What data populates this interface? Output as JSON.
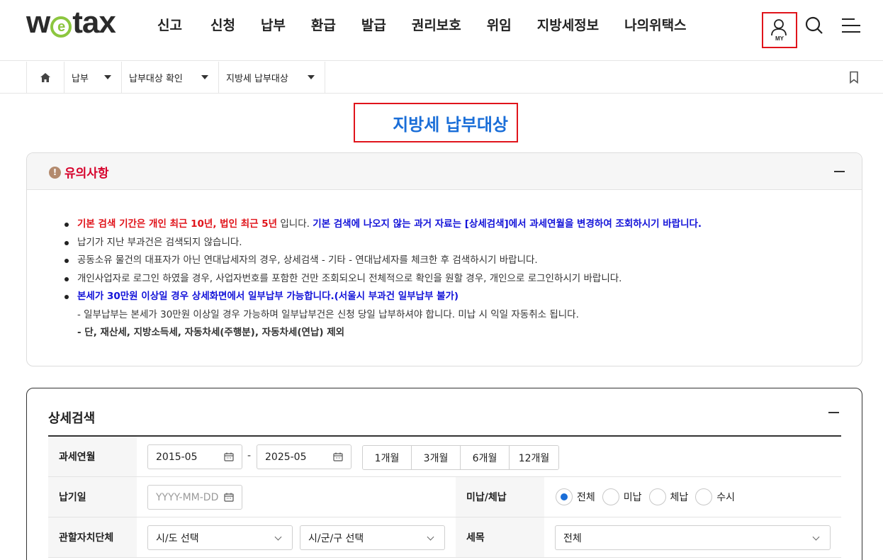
{
  "header": {
    "logo_prefix": "w",
    "logo_e": "e",
    "logo_suffix": "tax",
    "nav": [
      "신고",
      "신청",
      "납부",
      "환급",
      "발급",
      "권리보호",
      "위임",
      "지방세정보",
      "나의위택스"
    ],
    "my_label": "MY",
    "icons": {
      "my": "user-icon",
      "search": "search-icon",
      "menu": "menu-icon"
    }
  },
  "breadcrumb": {
    "home_icon": "home-icon",
    "items": [
      "납부",
      "납부대상 확인",
      "지방세 납부대상"
    ],
    "bookmark_icon": "bookmark-icon"
  },
  "page_title": "지방세 납부대상",
  "notice": {
    "title": "유의사항",
    "lines": {
      "l1_red1": "기본 검색 기간은 개인 최근 10년, 법인 최근 5년",
      "l1_plain": " 입니다. ",
      "l1_blue": "기본 검색에 나오지 않는 과거 자료는 [상세검색]에서 과세연월을 변경하여 조회하시기 바랍니다.",
      "l2": "납기가 지난 부과건은 검색되지 않습니다.",
      "l3": "공동소유 물건의 대표자가 아닌 연대납세자의 경우, 상세검색 - 기타 - 연대납세자를 체크한 후 검색하시기 바랍니다.",
      "l4": "개인사업자로 로그인 하였을 경우, 사업자번호를 포함한 건만 조회되오니 전체적으로 확인을 원할 경우, 개인으로 로그인하시기 바랍니다.",
      "l5_blue": "본세가 30만원 이상일 경우 상세화면에서 일부납부 가능합니다.(서울시 부과건 일부납부 불가)",
      "l6": "- 일부납부는 본세가 30만원 이상일 경우 가능하며 일부납부건은 신청 당일 납부하셔야 합니다. 미납 시 익일 자동취소 됩니다.",
      "l7": "- 단, 재산세, 지방소득세, 자동차세(주행분), 자동차세(연납) 제외"
    }
  },
  "search": {
    "title": "상세검색",
    "labels": {
      "period": "과세연월",
      "due": "납기일",
      "status": "미납/체납",
      "region": "관할자치단체",
      "tax_item": "세목"
    },
    "period_from": "2015-05",
    "period_to": "2025-05",
    "period_sep": "-",
    "period_buttons": [
      "1개월",
      "3개월",
      "6개월",
      "12개월"
    ],
    "due_placeholder": "YYYY-MM-DD",
    "status_options": [
      "전체",
      "미납",
      "체납",
      "수시"
    ],
    "status_selected": "전체",
    "sido_select": "시/도 선택",
    "sigungu_select": "시/군/구 선택",
    "tax_item_select": "전체"
  },
  "colors": {
    "accent_blue": "#1a6ed8",
    "alert_red": "#e0141b",
    "notice_red": "#d6002a",
    "logo_green": "#8cc63f"
  }
}
